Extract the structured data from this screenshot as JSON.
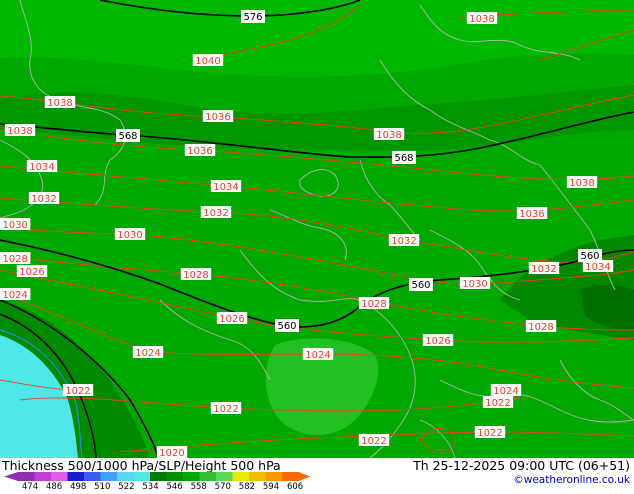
{
  "title": "Thickness 500/1000 hPa/SLP/Height 500 hPa",
  "datetime": "Th 25-12-2025 09:00 UTC (06+51)",
  "credit": "©weatheronline.co.uk",
  "colors": {
    "thickness_fills": [
      "#8b2fb5",
      "#c43cd6",
      "#e25ee8",
      "#1c1cc8",
      "#3a5cf0",
      "#3fa0f5",
      "#5ad6f2",
      "#4ee8e8",
      "#007a00",
      "#009100",
      "#00a800",
      "#2ec02e",
      "#5ad85a",
      "#eaea0a",
      "#f0c000",
      "#f59a00",
      "#ff6a00"
    ],
    "slp_isobar": "#e8402a",
    "height_contour": "#000000",
    "border": "#b4b4b4"
  },
  "legend": {
    "ticks": [
      "474",
      "486",
      "498",
      "510",
      "522",
      "534",
      "546",
      "558",
      "570",
      "582",
      "594",
      "606"
    ]
  },
  "height_labels": [
    "576",
    "568",
    "568",
    "560",
    "560",
    "560"
  ],
  "slp_labels": [
    "1038",
    "1040",
    "1038",
    "1036",
    "1038",
    "1038",
    "1036",
    "1038",
    "1034",
    "1034",
    "1032",
    "1032",
    "1036",
    "1030",
    "1032",
    "1028",
    "1026",
    "1028",
    "1032",
    "1030",
    "1034",
    "1024",
    "1026",
    "1028",
    "1026",
    "1028",
    "1024",
    "1024",
    "1022",
    "1022",
    "1024",
    "1022",
    "1022",
    "1020",
    "1030",
    "1022"
  ]
}
